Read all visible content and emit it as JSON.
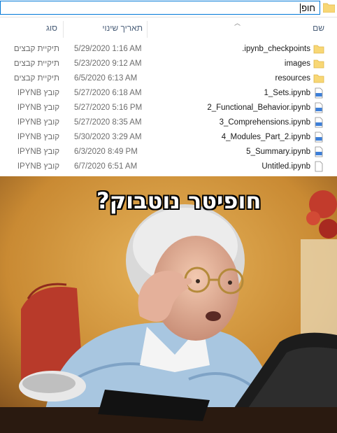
{
  "address": {
    "path": "חופ"
  },
  "columns": {
    "name": "שם",
    "date": "תאריך שינוי",
    "type": "סוג"
  },
  "files": [
    {
      "name": ".ipynb_checkpoints",
      "date": "5/29/2020 1:16 AM",
      "type": "תיקיית קבצים",
      "icon": "folder-icon"
    },
    {
      "name": "images",
      "date": "5/23/2020 9:12 AM",
      "type": "תיקיית קבצים",
      "icon": "folder-icon"
    },
    {
      "name": "resources",
      "date": "6/5/2020 6:13 AM",
      "type": "תיקיית קבצים",
      "icon": "folder-icon"
    },
    {
      "name": "1_Sets.ipynb",
      "date": "5/27/2020 6:18 AM",
      "type": "קובץ IPYNB",
      "icon": "notebook-file-icon"
    },
    {
      "name": "2_Functional_Behavior.ipynb",
      "date": "5/27/2020 5:16 PM",
      "type": "קובץ IPYNB",
      "icon": "notebook-file-icon"
    },
    {
      "name": "3_Comprehensions.ipynb",
      "date": "5/27/2020 8:35 AM",
      "type": "קובץ IPYNB",
      "icon": "notebook-file-icon"
    },
    {
      "name": "4_Modules_Part_2.ipynb",
      "date": "5/30/2020 3:29 AM",
      "type": "קובץ IPYNB",
      "icon": "notebook-file-icon"
    },
    {
      "name": "5_Summary.ipynb",
      "date": "6/3/2020 8:49 PM",
      "type": "קובץ IPYNB",
      "icon": "notebook-file-icon"
    },
    {
      "name": "Untitled.ipynb",
      "date": "6/7/2020 6:51 AM",
      "type": "קובץ IPYNB",
      "icon": "blank-file-icon"
    }
  ],
  "meme": {
    "caption": "חופיטר נוטבוק?"
  },
  "colors": {
    "folder": "#f2c94c",
    "notebook_accent": "#3c7fd9",
    "address_border": "#0078d7",
    "header_text": "#4c607a"
  }
}
